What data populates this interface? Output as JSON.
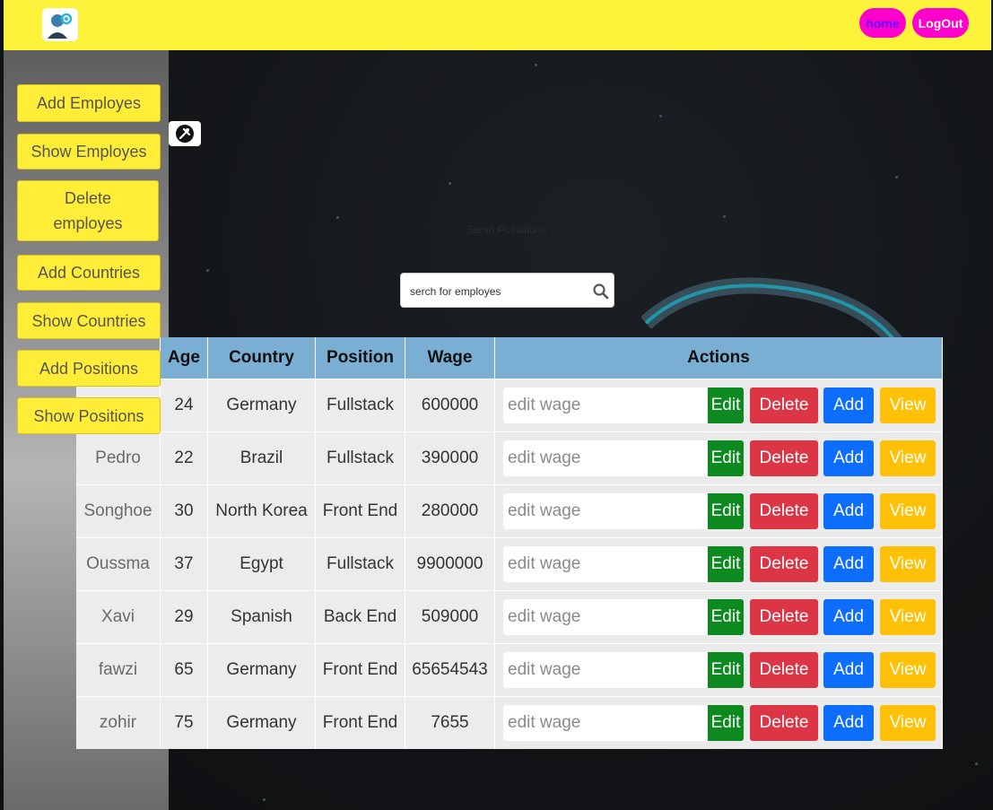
{
  "topbar": {
    "home_label": "home",
    "logout_label": "LogOut"
  },
  "sidebar": {
    "items": [
      {
        "label": "Add Employes"
      },
      {
        "label": "Show Employes"
      },
      {
        "label": "Delete employes"
      },
      {
        "label": "Add Countries"
      },
      {
        "label": "Show Countries"
      },
      {
        "label": "Add Positions"
      },
      {
        "label": "Show Positions"
      }
    ]
  },
  "main": {
    "faint_label": "Sersh Possitions",
    "search": {
      "placeholder": "serch for employes",
      "value": ""
    }
  },
  "table": {
    "columns": [
      "Age",
      "Country",
      "Position",
      "Wage",
      "Actions"
    ],
    "rows": [
      {
        "name": "",
        "age": "24",
        "country": "Germany",
        "position": "Fullstack",
        "wage": "600000"
      },
      {
        "name": "Pedro",
        "age": "22",
        "country": "Brazil",
        "position": "Fullstack",
        "wage": "390000"
      },
      {
        "name": "Songhoe",
        "age": "30",
        "country": "North Korea",
        "position": "Front End",
        "wage": "280000"
      },
      {
        "name": "Oussma",
        "age": "37",
        "country": "Egypt",
        "position": "Fullstack",
        "wage": "9900000"
      },
      {
        "name": "Xavi",
        "age": "29",
        "country": "Spanish",
        "position": "Back End",
        "wage": "509000"
      },
      {
        "name": "fawzi",
        "age": "65",
        "country": "Germany",
        "position": "Front End",
        "wage": "65654543"
      },
      {
        "name": "zohir",
        "age": "75",
        "country": "Germany",
        "position": "Front End",
        "wage": "7655"
      }
    ],
    "actions": {
      "wage_placeholder": "edit wage",
      "edit_label": "Edit",
      "delete_label": "Delete",
      "add_label": "Add",
      "view_label": "View"
    }
  },
  "colors": {
    "topbar": "#fff23b",
    "nav_pill": "#ff00cc",
    "sidebar_button": "#ffed38",
    "table_header": "#7aaed2",
    "edit": "#0d8a1f",
    "delete": "#dc3545",
    "add": "#0d6efd",
    "view": "#ffc107"
  },
  "icons": [
    "avatar-gear-logo-icon",
    "tools-icon",
    "search-icon"
  ]
}
